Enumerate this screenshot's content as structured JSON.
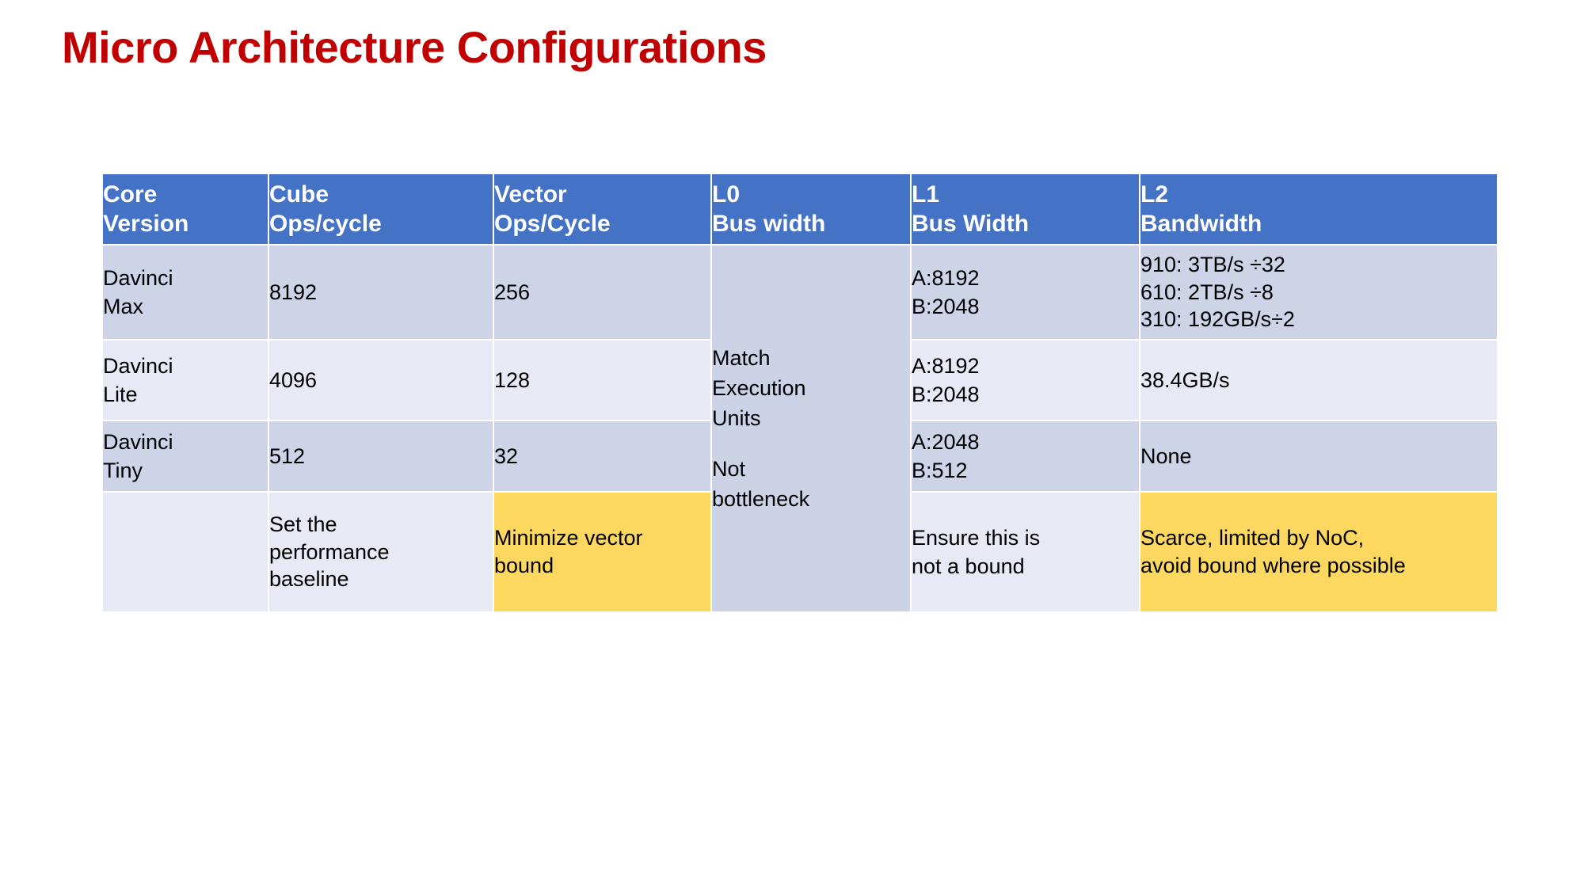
{
  "slide": {
    "title": "Micro Architecture Configurations",
    "title_color": "#C00000",
    "background_color": "#FFFFFF"
  },
  "table": {
    "header_bg": "#4472C4",
    "header_text_color": "#FFFFFF",
    "row_band_dark": "#CED4E8",
    "row_band_light": "#E7EAF4",
    "highlight_bg": "#FCD860",
    "columns": [
      {
        "id": "core_version",
        "line1": "Core",
        "line2": "Version"
      },
      {
        "id": "cube_ops",
        "line1": "Cube",
        "line2": "Ops/cycle"
      },
      {
        "id": "vector_ops",
        "line1": "Vector",
        "line2": "Ops/Cycle"
      },
      {
        "id": "l0_bus_width",
        "line1": "L0",
        "line2": "Bus width"
      },
      {
        "id": "l1_bus_width",
        "line1": "L1",
        "line2": "Bus Width"
      },
      {
        "id": "l2_bandwidth",
        "line1": "L2",
        "line2": "Bandwidth"
      }
    ],
    "l0_merged_cell": {
      "line1": "Match",
      "line2": "Execution",
      "line3": "Units",
      "line4": "",
      "line5": "Not",
      "line6": "bottleneck"
    },
    "rows": [
      {
        "core_version_l1": "Davinci",
        "core_version_l2": "Max",
        "cube_ops": "8192",
        "vector_ops": "256",
        "l1_bus_width_a": "A:8192",
        "l1_bus_width_b": "B:2048",
        "l2_bandwidth_l1": "910: 3TB/s ÷32",
        "l2_bandwidth_l2": "610: 2TB/s ÷8",
        "l2_bandwidth_l3": "310: 192GB/s÷2"
      },
      {
        "core_version_l1": "Davinci",
        "core_version_l2": "Lite",
        "cube_ops": "4096",
        "vector_ops": "128",
        "l1_bus_width_a": "A:8192",
        "l1_bus_width_b": "B:2048",
        "l2_bandwidth_l1": "38.4GB/s",
        "l2_bandwidth_l2": "",
        "l2_bandwidth_l3": ""
      },
      {
        "core_version_l1": "Davinci",
        "core_version_l2": "Tiny",
        "cube_ops": "512",
        "vector_ops": "32",
        "l1_bus_width_a": "A:2048",
        "l1_bus_width_b": "B:512",
        "l2_bandwidth_l1": "None",
        "l2_bandwidth_l2": "",
        "l2_bandwidth_l3": ""
      },
      {
        "core_version_l1": "",
        "core_version_l2": "",
        "cube_ops_l1": "Set the",
        "cube_ops_l2": "performance",
        "cube_ops_l3": "baseline",
        "vector_ops_l1": "Minimize vector",
        "vector_ops_l2": "bound",
        "l1_bus_width_a": "Ensure this is",
        "l1_bus_width_b": "not a bound",
        "l2_bandwidth_l1": "Scarce, limited by NoC,",
        "l2_bandwidth_l2": "avoid bound where possible",
        "l2_bandwidth_l3": ""
      }
    ]
  }
}
